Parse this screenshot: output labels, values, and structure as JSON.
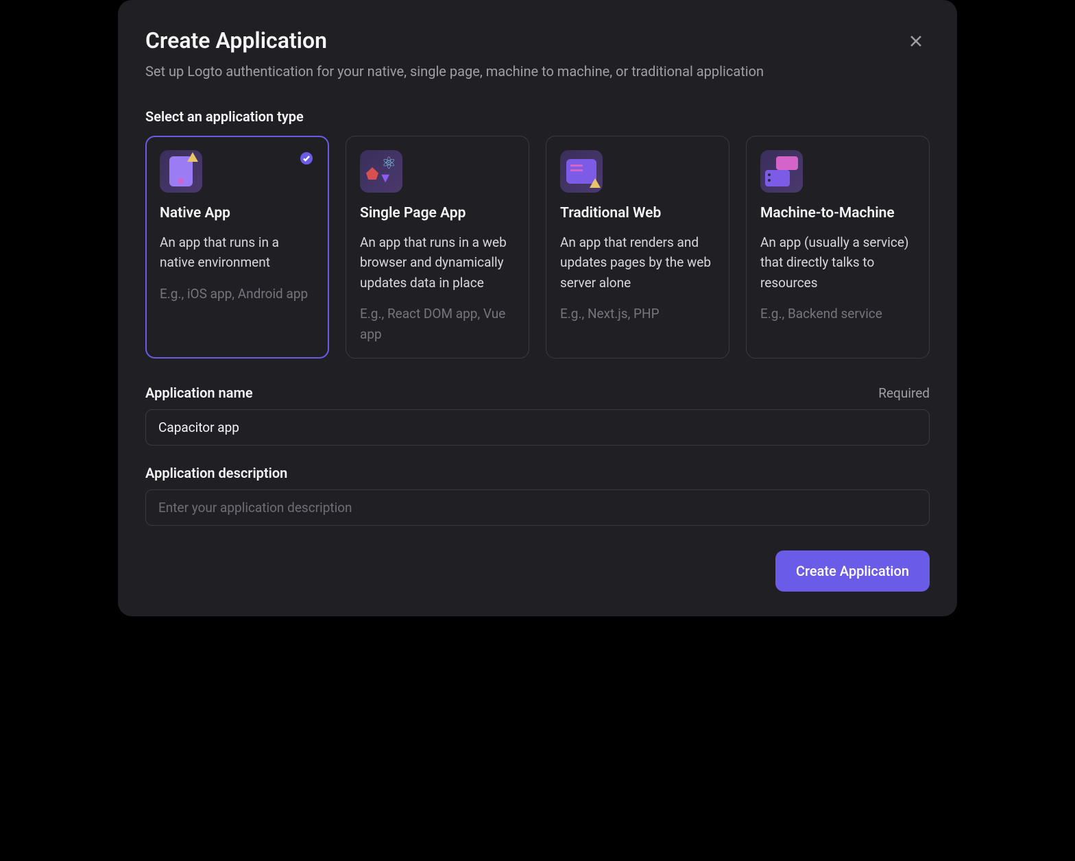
{
  "modal": {
    "title": "Create Application",
    "subtitle": "Set up Logto authentication for your native, single page, machine to machine, or traditional application"
  },
  "section_label": "Select an application type",
  "app_types": [
    {
      "title": "Native App",
      "description": "An app that runs in a native environment",
      "example": "E.g., iOS app, Android app",
      "selected": true
    },
    {
      "title": "Single Page App",
      "description": "An app that runs in a web browser and dynamically updates data in place",
      "example": "E.g., React DOM app, Vue app",
      "selected": false
    },
    {
      "title": "Traditional Web",
      "description": "An app that renders and updates pages by the web server alone",
      "example": "E.g., Next.js, PHP",
      "selected": false
    },
    {
      "title": "Machine-to-Machine",
      "description": "An app (usually a service) that directly talks to resources",
      "example": "E.g., Backend service",
      "selected": false
    }
  ],
  "name_field": {
    "label": "Application name",
    "required_text": "Required",
    "value": "Capacitor app"
  },
  "desc_field": {
    "label": "Application description",
    "placeholder": "Enter your application description",
    "value": ""
  },
  "footer": {
    "submit_label": "Create Application"
  }
}
